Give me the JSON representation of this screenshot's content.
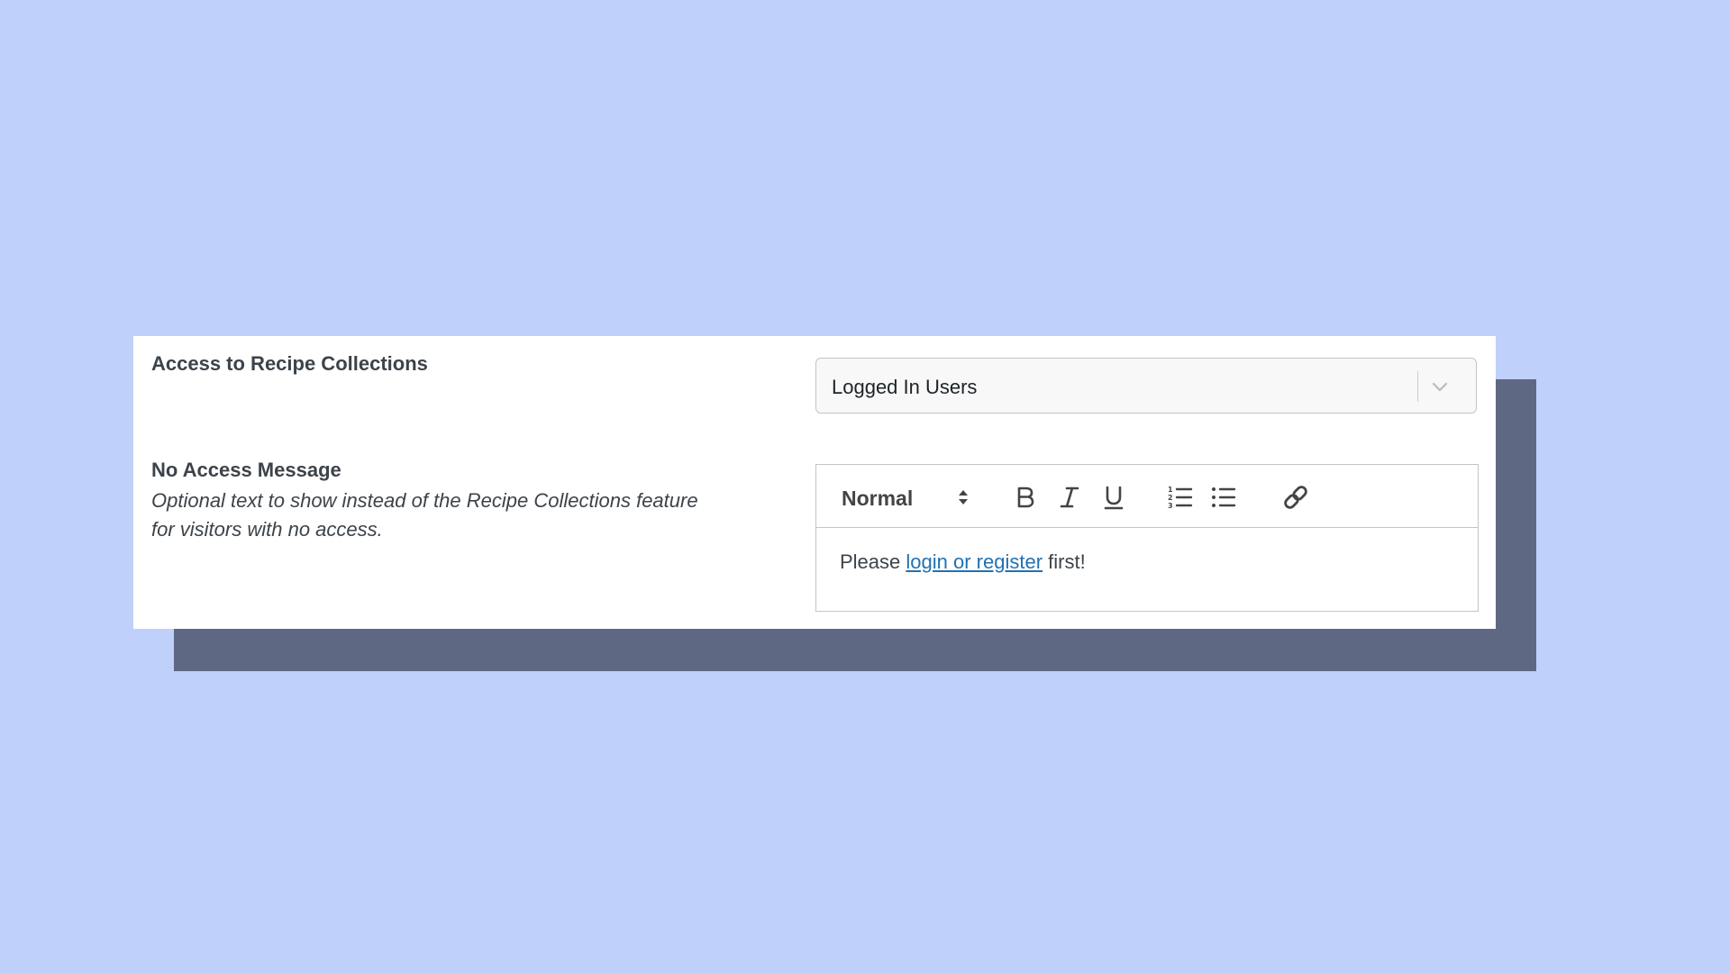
{
  "settings": {
    "access_label": "Access to Recipe Collections",
    "access_value": "Logged In Users",
    "no_access_label": "No Access Message",
    "no_access_description_line1": "Optional text to show instead of the Recipe Collections feature",
    "no_access_description_line2": "for visitors with no access."
  },
  "editor": {
    "format_value": "Normal",
    "toolbar_icons": [
      "bold-icon",
      "italic-icon",
      "underline-icon",
      "ordered-list-icon",
      "bullet-list-icon",
      "link-icon"
    ],
    "content_before": "Please ",
    "content_link": "login or register",
    "content_after": " first!"
  },
  "colors": {
    "background": "#bfd0fb",
    "shadow_block": "#5f6883",
    "link": "#2271b1",
    "text": "#3c434a"
  }
}
